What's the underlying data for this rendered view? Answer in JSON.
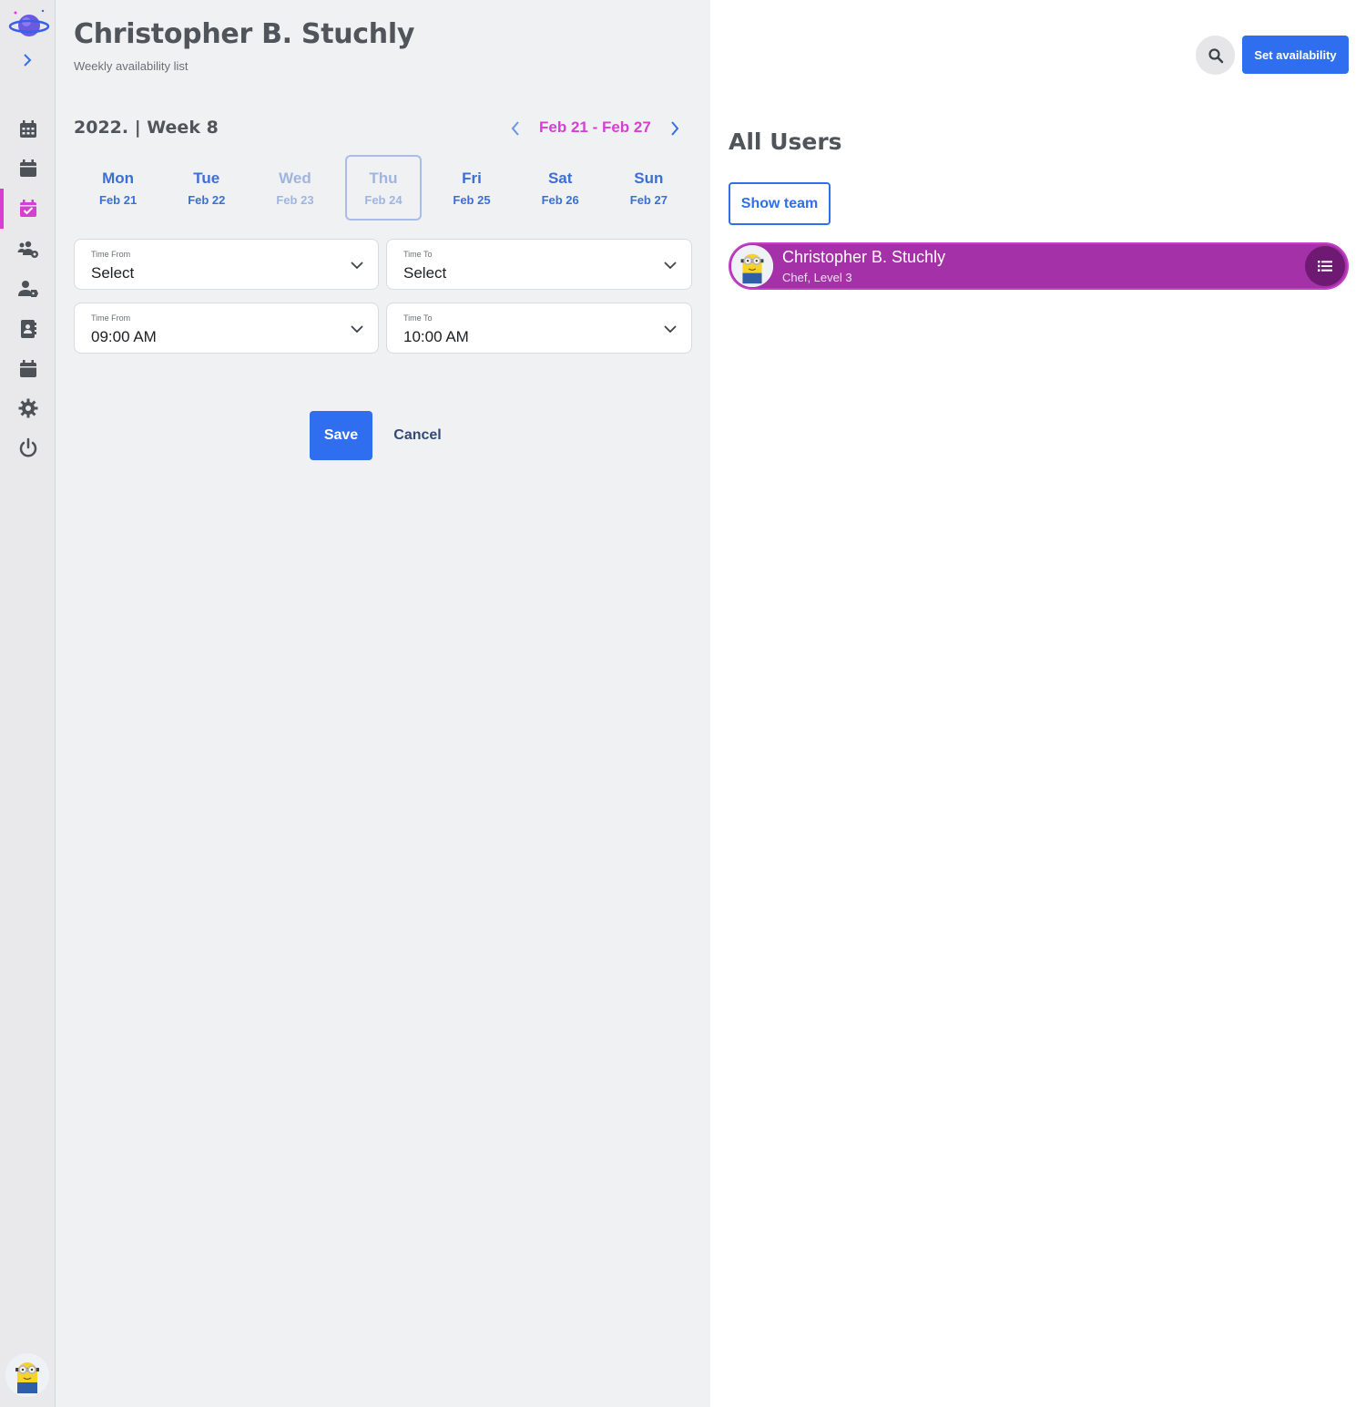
{
  "page": {
    "title": "Christopher B. Stuchly",
    "subtitle": "Weekly availability list"
  },
  "week": {
    "label": "2022. | Week 8",
    "range": "Feb 21 - Feb 27"
  },
  "days": [
    {
      "name": "Mon",
      "date": "Feb 21"
    },
    {
      "name": "Tue",
      "date": "Feb 22"
    },
    {
      "name": "Wed",
      "date": "Feb 23"
    },
    {
      "name": "Thu",
      "date": "Feb 24"
    },
    {
      "name": "Fri",
      "date": "Feb 25"
    },
    {
      "name": "Sat",
      "date": "Feb 26"
    },
    {
      "name": "Sun",
      "date": "Feb 27"
    }
  ],
  "fields": [
    {
      "label": "Time From",
      "value": "Select"
    },
    {
      "label": "Time To",
      "value": "Select"
    },
    {
      "label": "Time From",
      "value": "09:00 AM"
    },
    {
      "label": "Time To",
      "value": "10:00 AM"
    }
  ],
  "actions": {
    "save_label": "Save",
    "cancel_label": "Cancel"
  },
  "right": {
    "set_availability_label": "Set availability",
    "section_title": "All Users",
    "show_team_label": "Show team",
    "user": {
      "name": "Christopher B. Stuchly",
      "role": "Chef, Level 3"
    }
  },
  "sidebar": {
    "items": [
      {
        "icon": "calendar-grid-icon"
      },
      {
        "icon": "calendar-icon"
      },
      {
        "icon": "calendar-check-icon",
        "active": true
      },
      {
        "icon": "users-cog-icon"
      },
      {
        "icon": "user-tag-icon"
      },
      {
        "icon": "address-book-icon"
      },
      {
        "icon": "calendar-alt-icon"
      },
      {
        "icon": "gear-icon"
      },
      {
        "icon": "power-icon"
      }
    ]
  },
  "colors": {
    "accent": "#2f6fef",
    "highlight": "#d63fd2",
    "user_row": "#a531a8"
  }
}
